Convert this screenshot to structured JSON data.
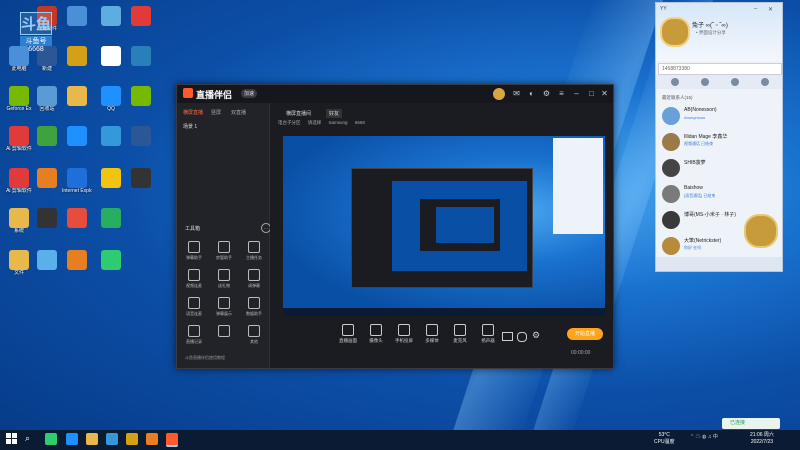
{
  "watermark": {
    "logo": "斗鱼",
    "sub": "斗鱼号",
    "num": "6668"
  },
  "desktop_icons": [
    {
      "label": "此电脑",
      "icon": "computer-icon",
      "color": "#4a90d9"
    },
    {
      "label": "Geforce Ex",
      "icon": "nvidia-icon",
      "color": "#76b900"
    },
    {
      "label": "Ai 剪辑软件",
      "icon": "app-icon",
      "color": "#e03a3a"
    },
    {
      "label": "Ai 剪辑软件",
      "icon": "app-icon",
      "color": "#e03a3a"
    },
    {
      "label": "系统",
      "icon": "folder-icon",
      "color": "#e8b84a"
    },
    {
      "label": "文件",
      "icon": "folder-icon",
      "color": "#e8b84a"
    },
    {
      "label": "网易邮件",
      "icon": "app-icon",
      "color": "#c0392b"
    },
    {
      "label": "新建",
      "icon": "word-icon",
      "color": "#2b5797"
    },
    {
      "label": "回收站",
      "icon": "recycle-icon",
      "color": "#5b9bd5"
    },
    {
      "label": "",
      "icon": "app-icon",
      "color": "#3ea33e"
    },
    {
      "label": "",
      "icon": "app-icon",
      "color": "#e67e22"
    },
    {
      "label": "",
      "icon": "app-icon",
      "color": "#333333"
    },
    {
      "label": "",
      "icon": "app-icon",
      "color": "#5ab0e8"
    },
    {
      "label": "",
      "icon": "app-icon",
      "color": "#4a90d9"
    },
    {
      "label": "",
      "icon": "app-icon",
      "color": "#d4a017"
    },
    {
      "label": "",
      "icon": "app-icon",
      "color": "#e8b84a"
    },
    {
      "label": "",
      "icon": "app-icon",
      "color": "#1e90ff"
    },
    {
      "label": "Internet Explorer",
      "icon": "ie-icon",
      "color": "#1e6fd9"
    },
    {
      "label": "",
      "icon": "app-icon",
      "color": "#e74c3c"
    },
    {
      "label": "",
      "icon": "app-icon",
      "color": "#e67e22"
    },
    {
      "label": "",
      "icon": "app-icon",
      "color": "#5dade2"
    },
    {
      "label": "",
      "icon": "app-icon",
      "color": "#ffffff"
    },
    {
      "label": "QQ",
      "icon": "qq-icon",
      "color": "#1e90ff"
    },
    {
      "label": "",
      "icon": "app-icon",
      "color": "#3498db"
    },
    {
      "label": "",
      "icon": "app-icon",
      "color": "#f1c40f"
    },
    {
      "label": "",
      "icon": "app-icon",
      "color": "#27ae60"
    },
    {
      "label": "",
      "icon": "app-icon",
      "color": "#2ecc71"
    },
    {
      "label": "",
      "icon": "app-icon",
      "color": "#e03a3a"
    },
    {
      "label": "",
      "icon": "app-icon",
      "color": "#2980b9"
    },
    {
      "label": "",
      "icon": "nvidia-icon",
      "color": "#76b900"
    },
    {
      "label": "",
      "icon": "word-icon",
      "color": "#2b5797"
    },
    {
      "label": "",
      "icon": "app-icon",
      "color": "#333333"
    }
  ],
  "app": {
    "title": "直播伴侣",
    "version": "加速"
  },
  "left_panel": {
    "tabs": [
      "横屏直播",
      "竖屏",
      "双直播"
    ],
    "scene": "场景 1",
    "toolbox_title": "工具箱",
    "tools": [
      "弹幕助手",
      "房管助手",
      "主播任务",
      "视频连麦",
      "送礼物",
      "调弹幕",
      "语音连麦",
      "弹幕展示",
      "数据助手",
      "直播记录",
      "",
      "其他"
    ],
    "footer": "斗鱼直播伴侣使用教程"
  },
  "main_panel": {
    "tabs": [
      "横屏直播间",
      "好友"
    ],
    "sub": [
      "电台子分区",
      "请选择",
      "Samsung",
      "6668"
    ]
  },
  "bottom_tools": [
    "直播画面",
    "摄像头",
    "手机投屏",
    "多媒体",
    "麦克风",
    "扬声器"
  ],
  "live_button": "开始直播",
  "timer": "00:00:00",
  "chat": {
    "app": "YY",
    "name": "兔子 ∞(˘ ᵕ ˘∞)",
    "sign": "• 界面设计分享",
    "search": "1458873380",
    "group": "最近联系人(15)",
    "contacts": [
      {
        "name": "AB(Nonesson)",
        "msg": "Anonymous",
        "color": "#6aa0d8"
      },
      {
        "name": "Illidan Mage 李鑫华",
        "msg": "视频通话 已结束",
        "color": "#9b7a4a"
      },
      {
        "name": "SHIB菠萝",
        "msg": "",
        "color": "#444444"
      },
      {
        "name": "Baishow",
        "msg": "[语音通话] 已结束",
        "color": "#7a7a7a"
      },
      {
        "name": "博哥(MS-小米子 · 林子)",
        "msg": "",
        "color": "#3a3a3a"
      },
      {
        "name": "大笨(Netrickster)",
        "msg": "你好 在吗",
        "color": "#b78a3c"
      }
    ]
  },
  "taskbar": {
    "weather": "53°C",
    "weather_sub": "CPU温度",
    "time": "21:06 周六",
    "date": "2022/7/23",
    "pill": "已连接"
  }
}
